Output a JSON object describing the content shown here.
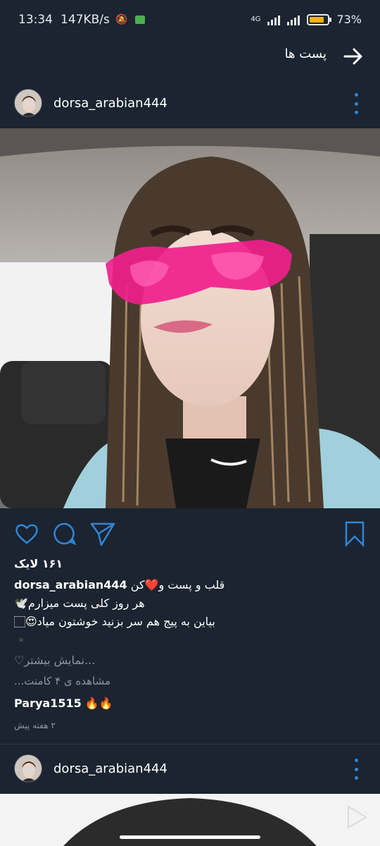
{
  "status_bar": {
    "time": "13:34",
    "speed": "147KB/s",
    "network": "4G",
    "battery_pct": "73%"
  },
  "app_bar": {
    "title": "پست ها"
  },
  "post": {
    "username": "dorsa_arabian444",
    "likes": "۱۶۱ لایک",
    "caption_user": "dorsa_arabian444",
    "caption_line1": "قلب و پست و❤️کن",
    "caption_line2": "هر روز کلی پست میزارم🕊️",
    "caption_line3": "بیاین به پیج هم سر بزنید خوشتون میاد😍🏻",
    "caption_line4": "▪️",
    "more": "...نمایش بیشتر♡",
    "view_comments": "مشاهده ی ۴ کامنت...",
    "comment_user": "Parya1515",
    "comment_text": "🔥🔥",
    "time_ago": "۲ هفته پیش"
  },
  "next_post": {
    "username": "dorsa_arabian444"
  },
  "colors": {
    "background": "#1b2430",
    "accent_blue": "#2f86d8",
    "glasses": "#f0208c"
  }
}
